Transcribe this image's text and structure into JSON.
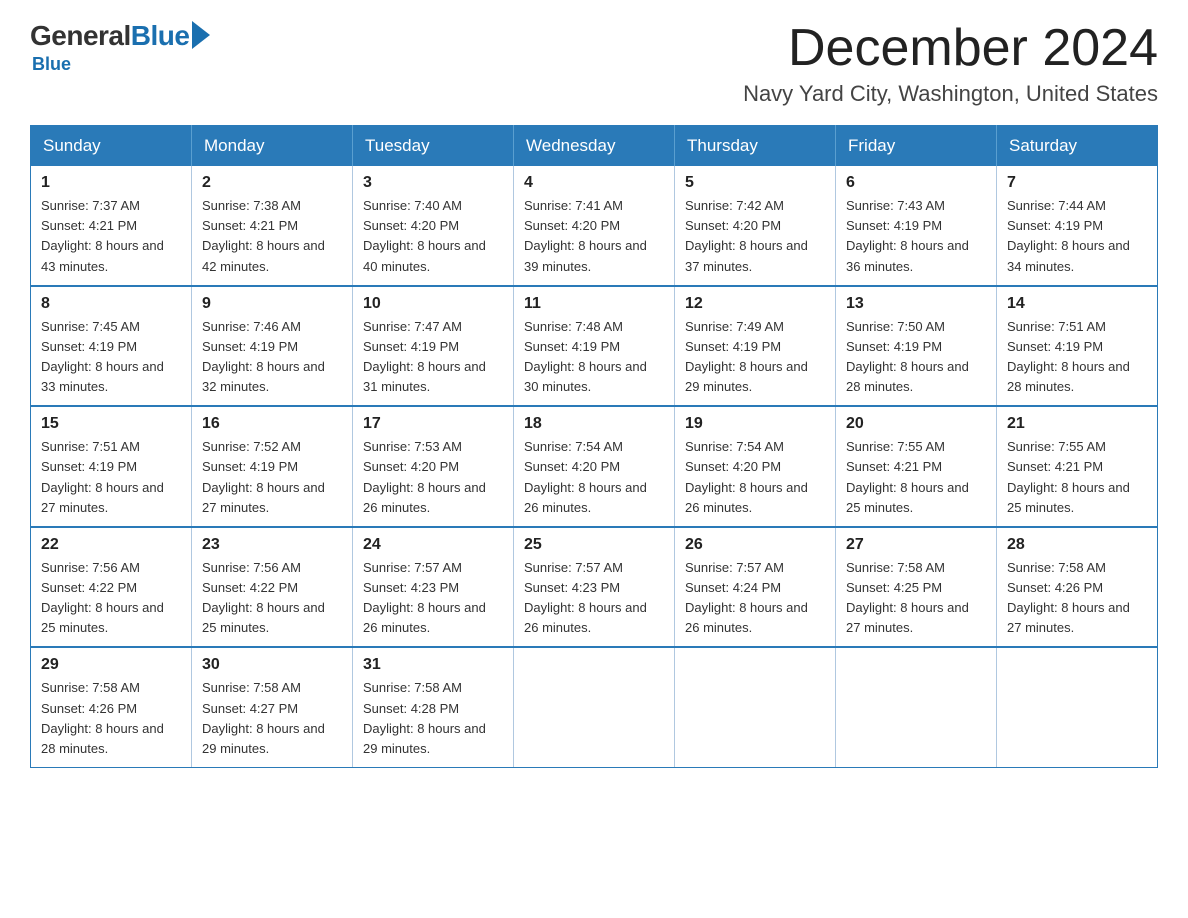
{
  "logo": {
    "general": "General",
    "blue": "Blue",
    "underline": "Blue"
  },
  "header": {
    "month_year": "December 2024",
    "location": "Navy Yard City, Washington, United States"
  },
  "weekdays": [
    "Sunday",
    "Monday",
    "Tuesday",
    "Wednesday",
    "Thursday",
    "Friday",
    "Saturday"
  ],
  "weeks": [
    [
      {
        "day": "1",
        "sunrise": "7:37 AM",
        "sunset": "4:21 PM",
        "daylight": "8 hours and 43 minutes."
      },
      {
        "day": "2",
        "sunrise": "7:38 AM",
        "sunset": "4:21 PM",
        "daylight": "8 hours and 42 minutes."
      },
      {
        "day": "3",
        "sunrise": "7:40 AM",
        "sunset": "4:20 PM",
        "daylight": "8 hours and 40 minutes."
      },
      {
        "day": "4",
        "sunrise": "7:41 AM",
        "sunset": "4:20 PM",
        "daylight": "8 hours and 39 minutes."
      },
      {
        "day": "5",
        "sunrise": "7:42 AM",
        "sunset": "4:20 PM",
        "daylight": "8 hours and 37 minutes."
      },
      {
        "day": "6",
        "sunrise": "7:43 AM",
        "sunset": "4:19 PM",
        "daylight": "8 hours and 36 minutes."
      },
      {
        "day": "7",
        "sunrise": "7:44 AM",
        "sunset": "4:19 PM",
        "daylight": "8 hours and 34 minutes."
      }
    ],
    [
      {
        "day": "8",
        "sunrise": "7:45 AM",
        "sunset": "4:19 PM",
        "daylight": "8 hours and 33 minutes."
      },
      {
        "day": "9",
        "sunrise": "7:46 AM",
        "sunset": "4:19 PM",
        "daylight": "8 hours and 32 minutes."
      },
      {
        "day": "10",
        "sunrise": "7:47 AM",
        "sunset": "4:19 PM",
        "daylight": "8 hours and 31 minutes."
      },
      {
        "day": "11",
        "sunrise": "7:48 AM",
        "sunset": "4:19 PM",
        "daylight": "8 hours and 30 minutes."
      },
      {
        "day": "12",
        "sunrise": "7:49 AM",
        "sunset": "4:19 PM",
        "daylight": "8 hours and 29 minutes."
      },
      {
        "day": "13",
        "sunrise": "7:50 AM",
        "sunset": "4:19 PM",
        "daylight": "8 hours and 28 minutes."
      },
      {
        "day": "14",
        "sunrise": "7:51 AM",
        "sunset": "4:19 PM",
        "daylight": "8 hours and 28 minutes."
      }
    ],
    [
      {
        "day": "15",
        "sunrise": "7:51 AM",
        "sunset": "4:19 PM",
        "daylight": "8 hours and 27 minutes."
      },
      {
        "day": "16",
        "sunrise": "7:52 AM",
        "sunset": "4:19 PM",
        "daylight": "8 hours and 27 minutes."
      },
      {
        "day": "17",
        "sunrise": "7:53 AM",
        "sunset": "4:20 PM",
        "daylight": "8 hours and 26 minutes."
      },
      {
        "day": "18",
        "sunrise": "7:54 AM",
        "sunset": "4:20 PM",
        "daylight": "8 hours and 26 minutes."
      },
      {
        "day": "19",
        "sunrise": "7:54 AM",
        "sunset": "4:20 PM",
        "daylight": "8 hours and 26 minutes."
      },
      {
        "day": "20",
        "sunrise": "7:55 AM",
        "sunset": "4:21 PM",
        "daylight": "8 hours and 25 minutes."
      },
      {
        "day": "21",
        "sunrise": "7:55 AM",
        "sunset": "4:21 PM",
        "daylight": "8 hours and 25 minutes."
      }
    ],
    [
      {
        "day": "22",
        "sunrise": "7:56 AM",
        "sunset": "4:22 PM",
        "daylight": "8 hours and 25 minutes."
      },
      {
        "day": "23",
        "sunrise": "7:56 AM",
        "sunset": "4:22 PM",
        "daylight": "8 hours and 25 minutes."
      },
      {
        "day": "24",
        "sunrise": "7:57 AM",
        "sunset": "4:23 PM",
        "daylight": "8 hours and 26 minutes."
      },
      {
        "day": "25",
        "sunrise": "7:57 AM",
        "sunset": "4:23 PM",
        "daylight": "8 hours and 26 minutes."
      },
      {
        "day": "26",
        "sunrise": "7:57 AM",
        "sunset": "4:24 PM",
        "daylight": "8 hours and 26 minutes."
      },
      {
        "day": "27",
        "sunrise": "7:58 AM",
        "sunset": "4:25 PM",
        "daylight": "8 hours and 27 minutes."
      },
      {
        "day": "28",
        "sunrise": "7:58 AM",
        "sunset": "4:26 PM",
        "daylight": "8 hours and 27 minutes."
      }
    ],
    [
      {
        "day": "29",
        "sunrise": "7:58 AM",
        "sunset": "4:26 PM",
        "daylight": "8 hours and 28 minutes."
      },
      {
        "day": "30",
        "sunrise": "7:58 AM",
        "sunset": "4:27 PM",
        "daylight": "8 hours and 29 minutes."
      },
      {
        "day": "31",
        "sunrise": "7:58 AM",
        "sunset": "4:28 PM",
        "daylight": "8 hours and 29 minutes."
      },
      null,
      null,
      null,
      null
    ]
  ]
}
